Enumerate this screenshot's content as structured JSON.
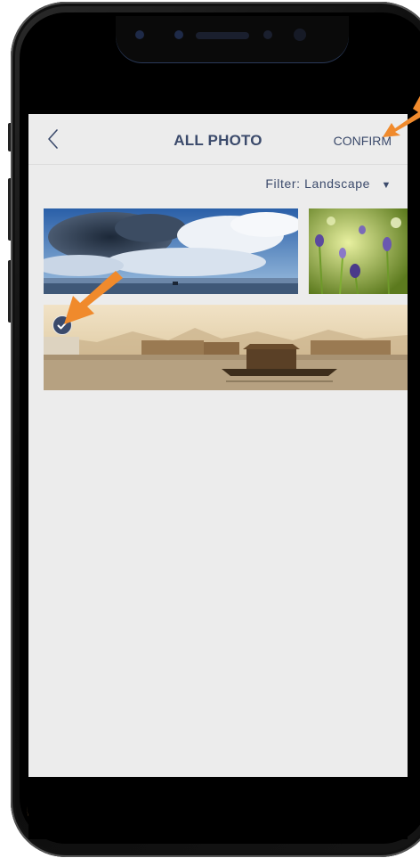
{
  "header": {
    "title": "ALL PHOTO",
    "confirm_label": "CONFIRM",
    "back_icon": "chevron-left-icon"
  },
  "filter": {
    "label": "Filter:",
    "value": "Landscape",
    "caret_icon": "caret-down-icon"
  },
  "photos": [
    {
      "subject": "cloudy sky over water",
      "selected": false
    },
    {
      "subject": "purple flowers in grass",
      "selected": false
    },
    {
      "subject": "lake with houseboats",
      "selected": true
    }
  ],
  "colors": {
    "accent": "#3b4a6b",
    "screen_bg": "#ececec",
    "annotation_arrow": "#f08a2c"
  },
  "icons": {
    "selected_check": "checkmark-icon"
  }
}
